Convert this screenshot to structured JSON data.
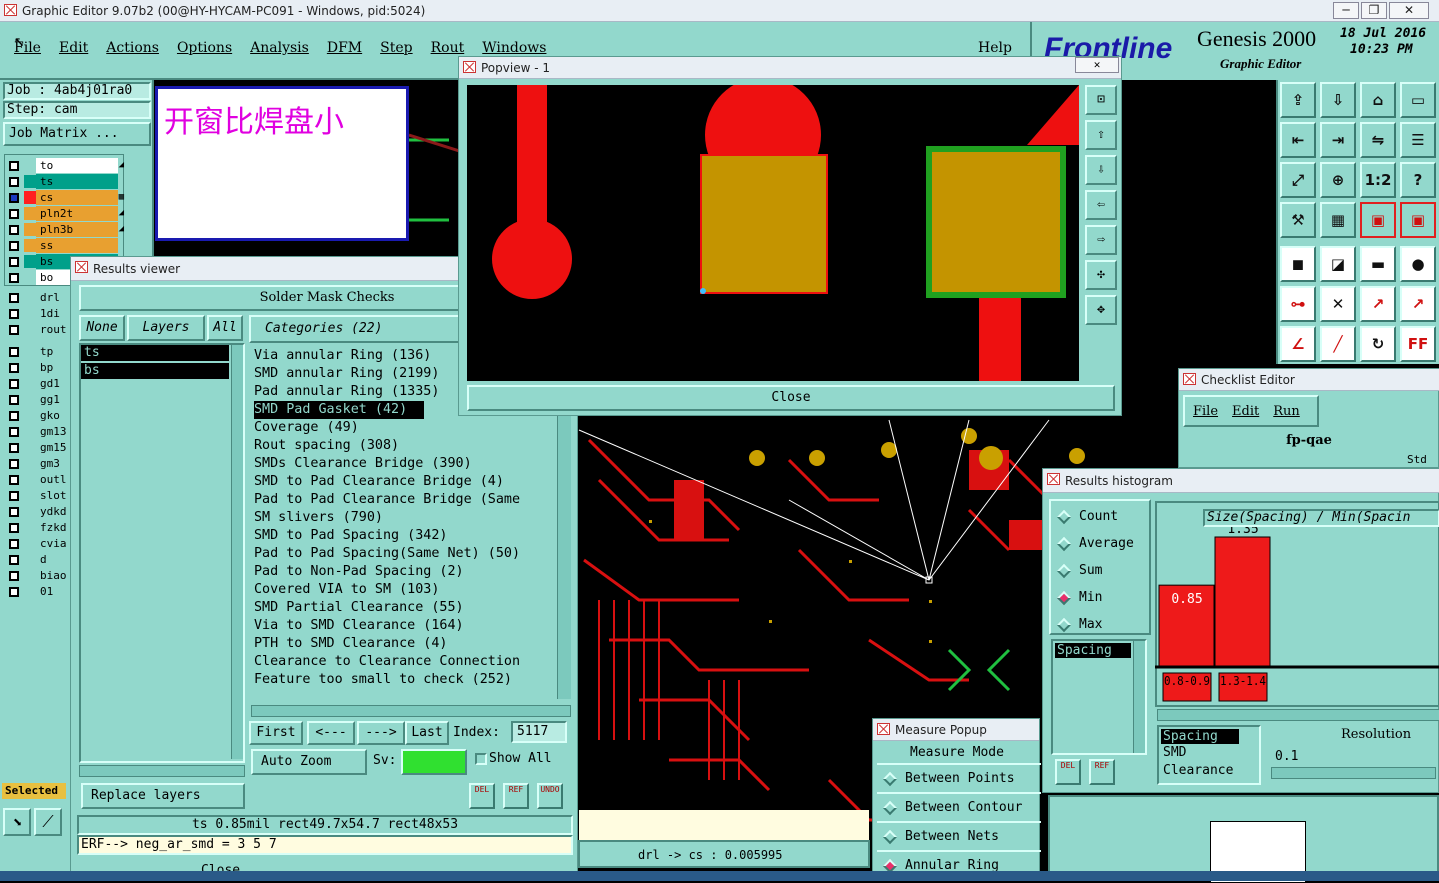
{
  "window": {
    "title": "Graphic Editor 9.07b2 (00@HY-HYCAM-PC091 - Windows, pid:5024)"
  },
  "menu": [
    "File",
    "Edit",
    "Actions",
    "Options",
    "Analysis",
    "DFM",
    "Step",
    "Rout",
    "Windows"
  ],
  "help": "Help",
  "brand": {
    "logo": "Frontline",
    "product": "Genesis 2000",
    "sub": "Graphic Editor",
    "date": "18 Jul 2016",
    "time": "10:23 PM"
  },
  "job": {
    "job": "Job : 4ab4j01ra0",
    "step": "Step: cam",
    "matrix": "Job Matrix ..."
  },
  "annotation": "开窗比焊盘小",
  "layers": [
    {
      "name": "to",
      "color": "#ffffff",
      "selected": false,
      "mark": "◢"
    },
    {
      "name": "ts",
      "color": "#00a08a",
      "selected": false,
      "mark": ""
    },
    {
      "name": "cs",
      "color": "#e8a030",
      "selected": true,
      "mark": "▦"
    },
    {
      "name": "pln2t",
      "color": "#e8a030",
      "selected": false,
      "mark": "◢"
    },
    {
      "name": "pln3b",
      "color": "#e8a030",
      "selected": false,
      "mark": "◢"
    },
    {
      "name": "ss",
      "color": "#e8a030",
      "selected": false,
      "mark": ""
    },
    {
      "name": "bs",
      "color": "#00a08a",
      "selected": false,
      "mark": ""
    },
    {
      "name": "bo",
      "color": "#ffffff",
      "selected": false,
      "mark": ""
    }
  ],
  "layers2": [
    "drl",
    "1di",
    "rout"
  ],
  "layers3": [
    "tp",
    "bp",
    "gd1",
    "gg1",
    "gko",
    "gm13",
    "gm15",
    "gm3",
    "outl",
    "slot",
    "ydkd",
    "fzkd",
    "cvia",
    "d",
    "biao",
    "01"
  ],
  "selected_label": "Selected",
  "results": {
    "title": "Results viewer",
    "heading": "Solder Mask Checks",
    "none": "None",
    "layers": "Layers",
    "all": "All",
    "categories_title": "Categories (22)",
    "layer_items": [
      "ts",
      "bs"
    ],
    "categories": [
      "Via annular Ring (136)",
      "SMD annular Ring (2199)",
      "Pad annular Ring (1335)",
      "SMD Pad Gasket (42)",
      "Coverage (49)",
      "Rout spacing (308)",
      "SMDs Clearance Bridge (390)",
      "SMD to Pad Clearance Bridge (4)",
      "Pad to Pad Clearance Bridge (Same",
      "SM slivers (790)",
      "SMD to Pad Spacing (342)",
      "Pad to Pad Spacing(Same Net) (50)",
      "Pad to Non-Pad Spacing (2)",
      "Covered VIA to SM (103)",
      "SMD Partial Clearance (55)",
      "Via to SMD Clearance (164)",
      "PTH to SMD Clearance (4)",
      "Clearance to Clearance Connection",
      "Feature too small to check (252)"
    ],
    "selected_category": 3,
    "first": "First",
    "prev": "<---",
    "next": "--->",
    "last": "Last",
    "index_label": "Index:",
    "index_value": "5117",
    "auto_zoom": "Auto Zoom",
    "sv": "Sv:",
    "show_all": "Show All",
    "replace": "Replace layers",
    "status": "ts 0.85mil   rect49.7x54.7   rect48x53",
    "erf": "ERF--> neg_ar_smd = 3 5 7",
    "close_partial": "Close"
  },
  "popview": {
    "title": "Popview - 1",
    "close": "Close"
  },
  "checklist": {
    "title": "Checklist Editor",
    "menu": [
      "File",
      "Edit",
      "Run"
    ],
    "name": "fp-qae",
    "std": "Std"
  },
  "histogram": {
    "title": "Results histogram",
    "modes": [
      "Count",
      "Average",
      "Sum",
      "Min",
      "Max"
    ],
    "active_mode": "Min",
    "chart_title": "Size(Spacing) / Min(Spacin",
    "list": [
      "Spacing"
    ],
    "list2": [
      "Spacing",
      "SMD",
      "Clearance"
    ],
    "resolution_label": "Resolution",
    "resolution_value": "0.1",
    "chart_data": {
      "type": "bar",
      "categories": [
        "0.8-0.9",
        "1.3-1.4"
      ],
      "values": [
        0.85,
        1.35
      ],
      "ylim": [
        0,
        1.35
      ]
    }
  },
  "measure": {
    "title": "Measure Popup",
    "mode": "Measure Mode",
    "items": [
      "Between Points",
      "Between Contour",
      "Between Nets",
      "Annular Ring"
    ]
  },
  "bottom_status": "drl -> cs : 0.005995"
}
